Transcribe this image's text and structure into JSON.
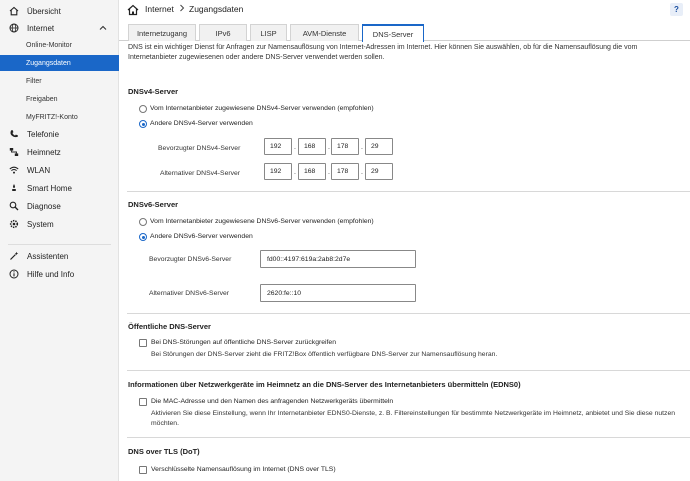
{
  "sidebar": {
    "items": [
      {
        "label": "Übersicht",
        "icon": "home-icon"
      },
      {
        "label": "Internet",
        "icon": "globe-icon",
        "expanded": true
      },
      {
        "label": "Telefonie",
        "icon": "phone-icon"
      },
      {
        "label": "Heimnetz",
        "icon": "network-icon"
      },
      {
        "label": "WLAN",
        "icon": "wifi-icon"
      },
      {
        "label": "Smart Home",
        "icon": "smart-home-icon"
      },
      {
        "label": "Diagnose",
        "icon": "diagnose-icon"
      },
      {
        "label": "System",
        "icon": "system-gear-icon"
      },
      {
        "label": "Assistenten",
        "icon": "wizard-icon"
      },
      {
        "label": "Hilfe und Info",
        "icon": "help-info-icon"
      }
    ],
    "internet_sub": [
      "Online-Monitor",
      "Zugangsdaten",
      "Filter",
      "Freigaben",
      "MyFRITZ!-Konto"
    ],
    "active_sub": "Zugangsdaten",
    "accent": "#1a67c8"
  },
  "breadcrumb": {
    "section": "Internet",
    "page": "Zugangsdaten"
  },
  "help_label": "?",
  "tabs": [
    "Internetzugang",
    "IPv6",
    "LISP",
    "AVM-Dienste",
    "DNS-Server"
  ],
  "active_tab": "DNS-Server",
  "intro": "DNS ist ein wichtiger Dienst für Anfragen zur Namensauflösung von Internet-Adressen im Internet. Hier können Sie auswählen, ob für die Namensauflösung die vom Internetanbieter zugewiesenen oder andere DNS-Server verwendet werden sollen.",
  "dnsv4": {
    "title": "DNSv4-Server",
    "option_provider": "Vom Internetanbieter zugewiesene DNSv4-Server verwenden (empfohlen)",
    "option_other": "Andere DNSv4-Server verwenden",
    "selected": "other",
    "preferred_label": "Bevorzugter DNSv4-Server",
    "preferred": [
      "192",
      "168",
      "178",
      "29"
    ],
    "alternative_label": "Alternativer DNSv4-Server",
    "alternative": [
      "192",
      "168",
      "178",
      "29"
    ]
  },
  "dnsv6": {
    "title": "DNSv6-Server",
    "option_provider": "Vom Internetanbieter zugewiesene DNSv6-Server verwenden (empfohlen)",
    "option_other": "Andere DNSv6-Server verwenden",
    "selected": "other",
    "preferred_label": "Bevorzugter DNSv6-Server",
    "preferred": "fd00::4197:619a:2ab8:2d7e",
    "alternative_label": "Alternativer DNSv6-Server",
    "alternative": "2620:fe::10"
  },
  "public_dns": {
    "title": "Öffentliche DNS-Server",
    "checkbox_label": "Bei DNS-Störungen auf öffentliche DNS-Server zurückgreifen",
    "checked": false,
    "help": "Bei Störungen der DNS-Server zieht die FRITZ!Box öffentlich verfügbare DNS-Server zur Namensauflösung heran."
  },
  "edns0": {
    "title": "Informationen über Netzwerkgeräte im Heimnetz an die DNS-Server des Internetanbieters übermitteln (EDNS0)",
    "checkbox_label": "Die MAC-Adresse und den Namen des anfragenden Netzwerkgeräts übermitteln",
    "checked": false,
    "help_line1": "Aktivieren Sie diese Einstellung, wenn Ihr Internetanbieter EDNS0-Dienste, z. B. Filtereinstellungen für bestimmte Netzwerkgeräte im Heimnetz, anbietet und Sie diese nutzen",
    "help_line2": "möchten."
  },
  "dot": {
    "title": "DNS over TLS (DoT)",
    "checkbox_label": "Verschlüsselte Namensauflösung im Internet (DNS over TLS)",
    "checked": false
  }
}
